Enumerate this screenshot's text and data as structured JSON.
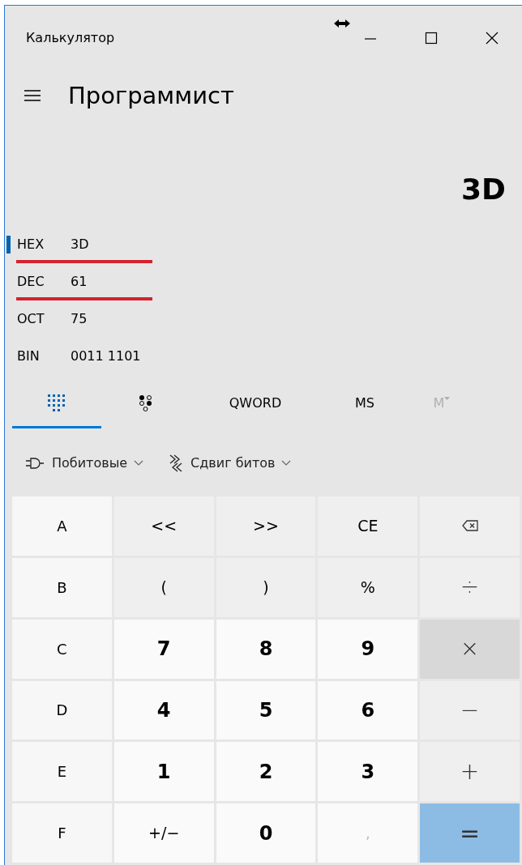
{
  "window": {
    "title": "Калькулятор"
  },
  "mode": {
    "title": "Программист"
  },
  "display": {
    "value": "3D"
  },
  "radix": [
    {
      "label": "HEX",
      "value": "3D",
      "selected": true,
      "underlined": true
    },
    {
      "label": "DEC",
      "value": "61",
      "selected": false,
      "underlined": true
    },
    {
      "label": "OCT",
      "value": "75",
      "selected": false,
      "underlined": false
    },
    {
      "label": "BIN",
      "value": "0011 1101",
      "selected": false,
      "underlined": false
    }
  ],
  "tabs": [
    {
      "kind": "keypad",
      "selected": true,
      "disabled": false
    },
    {
      "kind": "bits",
      "selected": false,
      "disabled": false
    },
    {
      "kind": "text",
      "label": "QWORD",
      "selected": false,
      "disabled": false
    },
    {
      "kind": "text",
      "label": "MS",
      "selected": false,
      "disabled": false
    },
    {
      "kind": "menu",
      "label": "M",
      "selected": false,
      "disabled": true
    }
  ],
  "dropdowns": [
    {
      "kind": "bitwise",
      "label": "Побитовые"
    },
    {
      "kind": "shift",
      "label": "Сдвиг битов"
    }
  ],
  "keys": [
    [
      {
        "kind": "letter",
        "label": "A",
        "hovered": false,
        "disabled": false
      },
      {
        "kind": "operator",
        "label": "<<",
        "hovered": false,
        "disabled": false
      },
      {
        "kind": "operator",
        "label": ">>",
        "hovered": false,
        "disabled": false
      },
      {
        "kind": "operator",
        "label": "CE",
        "hovered": false,
        "disabled": false
      },
      {
        "kind": "backspace",
        "hovered": false,
        "disabled": false
      }
    ],
    [
      {
        "kind": "letter",
        "label": "B",
        "hovered": false,
        "disabled": false
      },
      {
        "kind": "operator",
        "label": "(",
        "hovered": false,
        "disabled": false
      },
      {
        "kind": "operator",
        "label": ")",
        "hovered": false,
        "disabled": false
      },
      {
        "kind": "operator",
        "label": "%",
        "hovered": false,
        "disabled": false
      },
      {
        "kind": "math",
        "label": "÷",
        "hovered": false,
        "disabled": false
      }
    ],
    [
      {
        "kind": "letter",
        "label": "C",
        "hovered": false,
        "disabled": false
      },
      {
        "kind": "digit",
        "label": "7",
        "hovered": false,
        "disabled": false
      },
      {
        "kind": "digit",
        "label": "8",
        "hovered": false,
        "disabled": false
      },
      {
        "kind": "digit",
        "label": "9",
        "hovered": false,
        "disabled": false
      },
      {
        "kind": "math",
        "label": "×",
        "hovered": true,
        "disabled": false
      }
    ],
    [
      {
        "kind": "letter",
        "label": "D",
        "hovered": false,
        "disabled": false
      },
      {
        "kind": "digit",
        "label": "4",
        "hovered": false,
        "disabled": false
      },
      {
        "kind": "digit",
        "label": "5",
        "hovered": false,
        "disabled": false
      },
      {
        "kind": "digit",
        "label": "6",
        "hovered": false,
        "disabled": false
      },
      {
        "kind": "math",
        "label": "−",
        "hovered": false,
        "disabled": false
      }
    ],
    [
      {
        "kind": "letter",
        "label": "E",
        "hovered": false,
        "disabled": false
      },
      {
        "kind": "digit",
        "label": "1",
        "hovered": false,
        "disabled": false
      },
      {
        "kind": "digit",
        "label": "2",
        "hovered": false,
        "disabled": false
      },
      {
        "kind": "digit",
        "label": "3",
        "hovered": false,
        "disabled": false
      },
      {
        "kind": "math",
        "label": "+",
        "hovered": false,
        "disabled": false
      }
    ],
    [
      {
        "kind": "letter",
        "label": "F",
        "hovered": false,
        "disabled": false
      },
      {
        "kind": "sign",
        "label": "+/−",
        "hovered": false,
        "disabled": false
      },
      {
        "kind": "digit",
        "label": "0",
        "hovered": false,
        "disabled": false
      },
      {
        "kind": "digit",
        "label": ",",
        "hovered": false,
        "disabled": true
      },
      {
        "kind": "equals",
        "label": "=",
        "hovered": false,
        "disabled": false
      }
    ]
  ]
}
